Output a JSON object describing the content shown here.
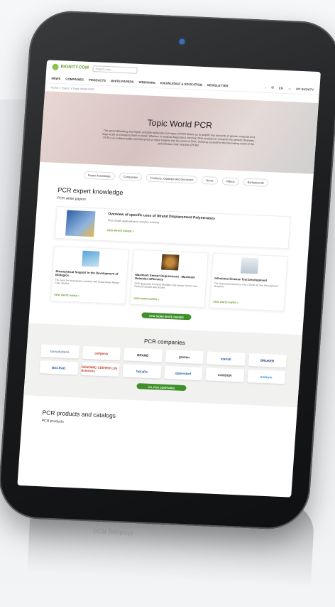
{
  "header": {
    "logo_text": "BIGNITY.COM",
    "search_placeholder": "Search now...",
    "nav": [
      "NEWS",
      "COMPANIES",
      "PRODUCTS",
      "WHITE PAPERS",
      "WEBINARS",
      "KNOWLEDGE & EDUCATION",
      "NEWSLETTER"
    ],
    "lang": "EN",
    "account": "MY BIGNITY"
  },
  "breadcrumb": "Home > Topics > Topic World PCR",
  "hero": {
    "title": "Topic World PCR",
    "text": "This groundbreaking and highly versatile molecular technique of PCR allows us to amplify tiny amounts of genetic material on a large scale and analyze them in detail. Whether in medical diagnostics, forensic DNA analysis or research into genetic diseases - PCR is an indispensable tool that gives us deep insights into the world of DNA. Immerse yourself in the fascinating world of the polymerase chain reaction (PCR)!"
  },
  "tabs": [
    "Expert knowledge",
    "Companies",
    "Products, Catalogs and brochures",
    "News",
    "Videos",
    "Backgrounds"
  ],
  "expert": {
    "title": "PCR expert knowledge",
    "subtitle": "PCR white papers",
    "feature": {
      "title": "Overview of specific uses of Strand Displacement Polymerases",
      "text": "From simple applications to complex methods",
      "link": "VIEW WHITE PAPER >"
    },
    "cards": [
      {
        "title": "Bioanalytical Support in the Development of Biologics",
        "text": "The need for bioanalysis combined with broad Assay Range - Case Studies",
        "link": "VIEW WHITE PAPER >"
      },
      {
        "title": "Maximum Sensor Requirement - Maximum Detection Efficiency",
        "text": "PCR diagnostic Compact Multiplex real sensor Sensor test. Perfectly specific test results",
        "link": "VIEW WHITE PAPER >"
      },
      {
        "title": "Infectious Disease Test Development",
        "text": "The Speed and Accuracy Your COVID-19 Test Development Requires",
        "link": "VIEW WHITE PAPER >"
      }
    ],
    "more_button": "VIEW MORE WHITE PAPERS"
  },
  "companies": {
    "title": "PCR companies",
    "logos": [
      {
        "name": "biosolutions",
        "color": "#6b8fb5"
      },
      {
        "name": "cellgenix",
        "color": "#c0392b"
      },
      {
        "name": "BRAND",
        "color": "#222222"
      },
      {
        "name": "greiner",
        "color": "#222222"
      },
      {
        "name": "starlab",
        "color": "#1f5fa8"
      },
      {
        "name": "BRUKER",
        "color": "#1f3f7a"
      },
      {
        "name": "BIO-RAD",
        "color": "#1f5fa8"
      },
      {
        "name": "GENOMIC CENTER Life Sciences",
        "color": "#c0392b"
      },
      {
        "name": "TaKaRa",
        "color": "#1f5fa8"
      },
      {
        "name": "eppendorf",
        "color": "#1f5fa8"
      },
      {
        "name": "CANDOR",
        "color": "#333333"
      },
      {
        "name": "molzym",
        "color": "#2d8fcf"
      }
    ],
    "button": "ALL PCR COMPANIES"
  },
  "products": {
    "title": "PCR products and catalogs",
    "subtitle": "PCR products"
  },
  "reflection": {
    "line1": "PCR products and catalogs",
    "line2": "PCR products"
  }
}
